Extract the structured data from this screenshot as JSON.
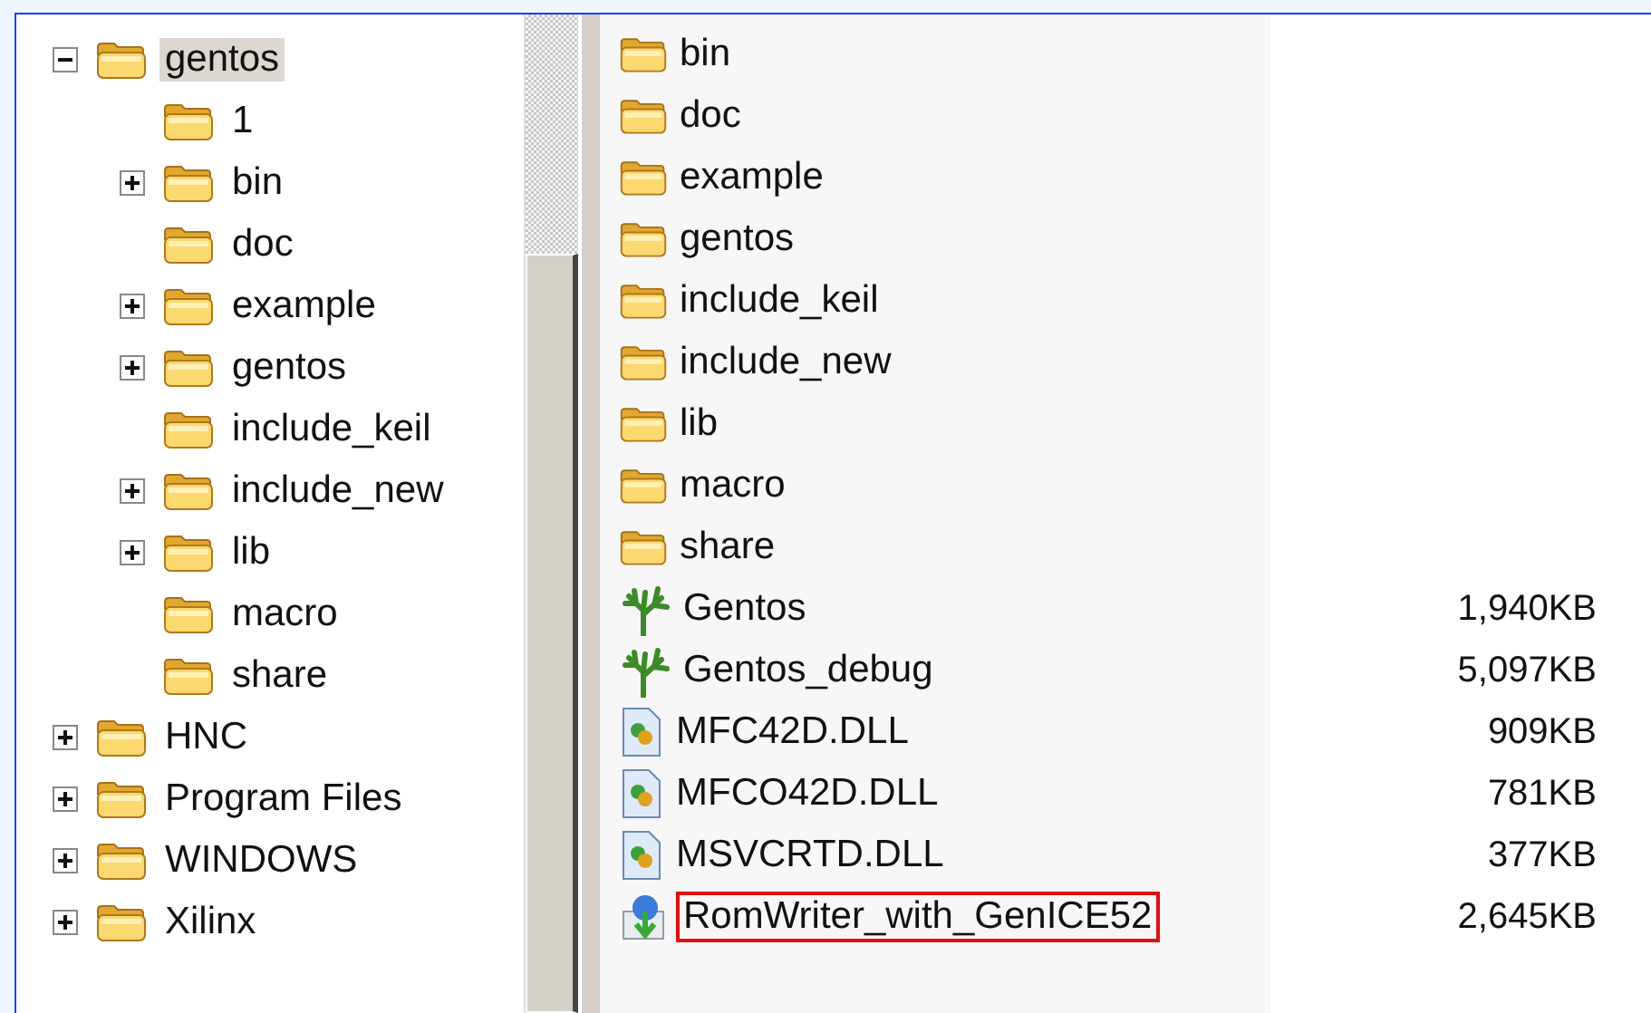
{
  "tree": [
    {
      "name": "gentos",
      "expanded": true,
      "selected": true,
      "children": [
        {
          "name": "1",
          "selected": false
        },
        {
          "name": "bin",
          "expanded": false,
          "selected": false
        },
        {
          "name": "doc",
          "selected": false
        },
        {
          "name": "example",
          "expanded": false,
          "selected": false
        },
        {
          "name": "gentos",
          "expanded": false,
          "selected": false
        },
        {
          "name": "include_keil",
          "selected": false
        },
        {
          "name": "include_new",
          "expanded": false,
          "selected": false
        },
        {
          "name": "lib",
          "expanded": false,
          "selected": false
        },
        {
          "name": "macro",
          "selected": false
        },
        {
          "name": "share",
          "selected": false
        }
      ]
    },
    {
      "name": "HNC",
      "expanded": false,
      "selected": false
    },
    {
      "name": "Program Files",
      "expanded": false,
      "selected": false
    },
    {
      "name": "WINDOWS",
      "expanded": false,
      "selected": false
    },
    {
      "name": "Xilinx",
      "expanded": false,
      "selected": false
    }
  ],
  "files": [
    {
      "kind": "folder",
      "name": "bin",
      "highlighted": false
    },
    {
      "kind": "folder",
      "name": "doc",
      "highlighted": false
    },
    {
      "kind": "folder",
      "name": "example",
      "highlighted": false
    },
    {
      "kind": "folder",
      "name": "gentos",
      "highlighted": false
    },
    {
      "kind": "folder",
      "name": "include_keil",
      "highlighted": false
    },
    {
      "kind": "folder",
      "name": "include_new",
      "highlighted": false
    },
    {
      "kind": "folder",
      "name": "lib",
      "highlighted": false
    },
    {
      "kind": "folder",
      "name": "macro",
      "highlighted": false
    },
    {
      "kind": "folder",
      "name": "share",
      "highlighted": false
    },
    {
      "kind": "app",
      "name": "Gentos",
      "size": "1,940KB",
      "highlighted": false
    },
    {
      "kind": "app",
      "name": "Gentos_debug",
      "size": "5,097KB",
      "highlighted": false
    },
    {
      "kind": "dll",
      "name": "MFC42D.DLL",
      "size": "909KB",
      "highlighted": false
    },
    {
      "kind": "dll",
      "name": "MFCO42D.DLL",
      "size": "781KB",
      "highlighted": false
    },
    {
      "kind": "dll",
      "name": "MSVCRTD.DLL",
      "size": "377KB",
      "highlighted": false
    },
    {
      "kind": "installer",
      "name": "RomWriter_with_GenICE52",
      "size": "2,645KB",
      "highlighted": true
    }
  ]
}
